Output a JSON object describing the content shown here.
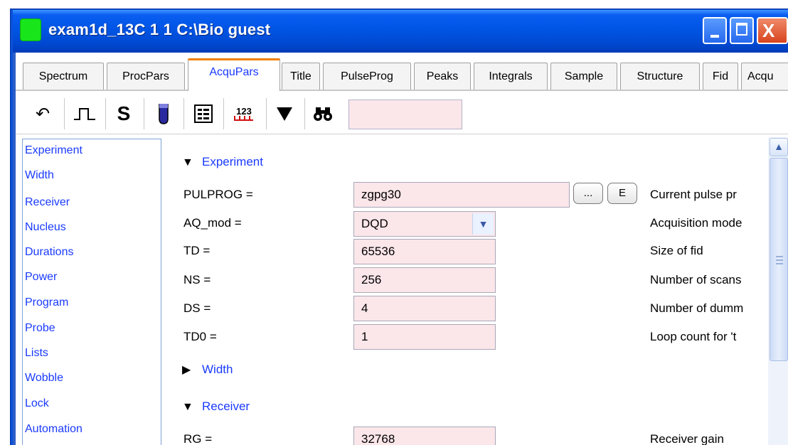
{
  "window": {
    "title": "exam1d_13C  1  1  C:\\Bio  guest",
    "status_color": "#18e61a",
    "minimize_label": "",
    "maximize_label": "",
    "close_label": "X"
  },
  "tabs": [
    {
      "label": "Spectrum",
      "active": false
    },
    {
      "label": "ProcPars",
      "active": false
    },
    {
      "label": "AcquPars",
      "active": true
    },
    {
      "label": "Title",
      "active": false
    },
    {
      "label": "PulseProg",
      "active": false
    },
    {
      "label": "Peaks",
      "active": false
    },
    {
      "label": "Integrals",
      "active": false
    },
    {
      "label": "Sample",
      "active": false
    },
    {
      "label": "Structure",
      "active": false
    },
    {
      "label": "Fid",
      "active": false
    },
    {
      "label": "Acqu",
      "active": false
    }
  ],
  "toolbar": {
    "icons": [
      "undo-icon",
      "pulse-program-icon",
      "S",
      "probe-tube-icon",
      "parameter-table-icon",
      "123",
      "filter-triangle-icon",
      "binoculars-icon"
    ],
    "s_label": "S",
    "num_label": "123",
    "search_value": ""
  },
  "sidebar": {
    "items": [
      "Experiment",
      "Width",
      "Receiver",
      "Nucleus",
      "Durations",
      "Power",
      "Program",
      "Probe",
      "Lists",
      "Wobble",
      "Lock",
      "Automation"
    ]
  },
  "sections": {
    "experiment": {
      "title": "Experiment",
      "expanded": true
    },
    "width": {
      "title": "Width",
      "expanded": false
    },
    "receiver": {
      "title": "Receiver",
      "expanded": true
    }
  },
  "params": {
    "pulprog": {
      "label": "PULPROG =",
      "value": "zgpg30",
      "desc": "Current pulse pr",
      "browse_label": "...",
      "edit_label": "E"
    },
    "aq_mod": {
      "label": "AQ_mod =",
      "value": "DQD",
      "desc": "Acquisition mode"
    },
    "td": {
      "label": "TD =",
      "value": "65536",
      "desc": "Size of fid"
    },
    "ns": {
      "label": "NS =",
      "value": "256",
      "desc": "Number of scans"
    },
    "ds": {
      "label": "DS =",
      "value": "4",
      "desc": "Number of dumm"
    },
    "td0": {
      "label": "TD0 =",
      "value": "1",
      "desc": "Loop count for 't"
    },
    "rg": {
      "label": "RG =",
      "value": "32768",
      "desc": "Receiver gain"
    }
  },
  "colors": {
    "titlebar": "#0055e5",
    "active_tab_accent": "#f08000",
    "link_blue": "#1a3aff",
    "field_bg": "#fbe6ea"
  }
}
